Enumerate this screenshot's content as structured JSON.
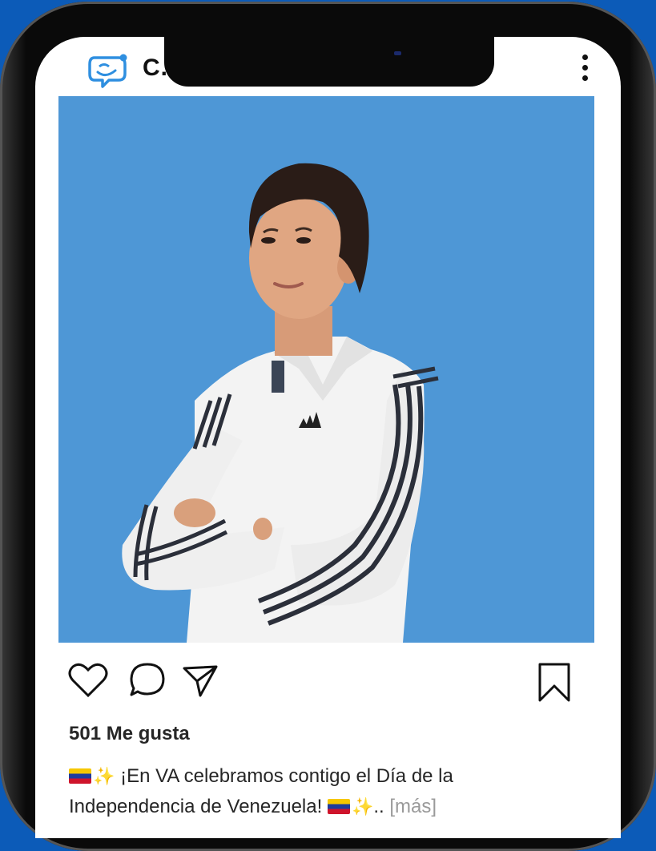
{
  "post": {
    "username": "C.",
    "likes": "501 Me gusta",
    "caption_line1": "¡En VA celebramos contigo el Día de la",
    "caption_line2": "Independencia de Venezuela!",
    "caption_tail": "..",
    "more_label": "[más]"
  },
  "icons": {
    "logo": "chat-bubble-smile-logo",
    "menu": "more-vertical-icon",
    "like": "heart-icon",
    "comment": "comment-icon",
    "share": "send-icon",
    "save": "bookmark-icon",
    "flag": "venezuela-flag-emoji",
    "sparkles": "sparkles-emoji"
  },
  "colors": {
    "page_background": "#0c5bb8",
    "photo_background": "#4e97d6",
    "logo_blue": "#2f8fe0",
    "text": "#262626",
    "more_link": "#9a9a9a"
  }
}
